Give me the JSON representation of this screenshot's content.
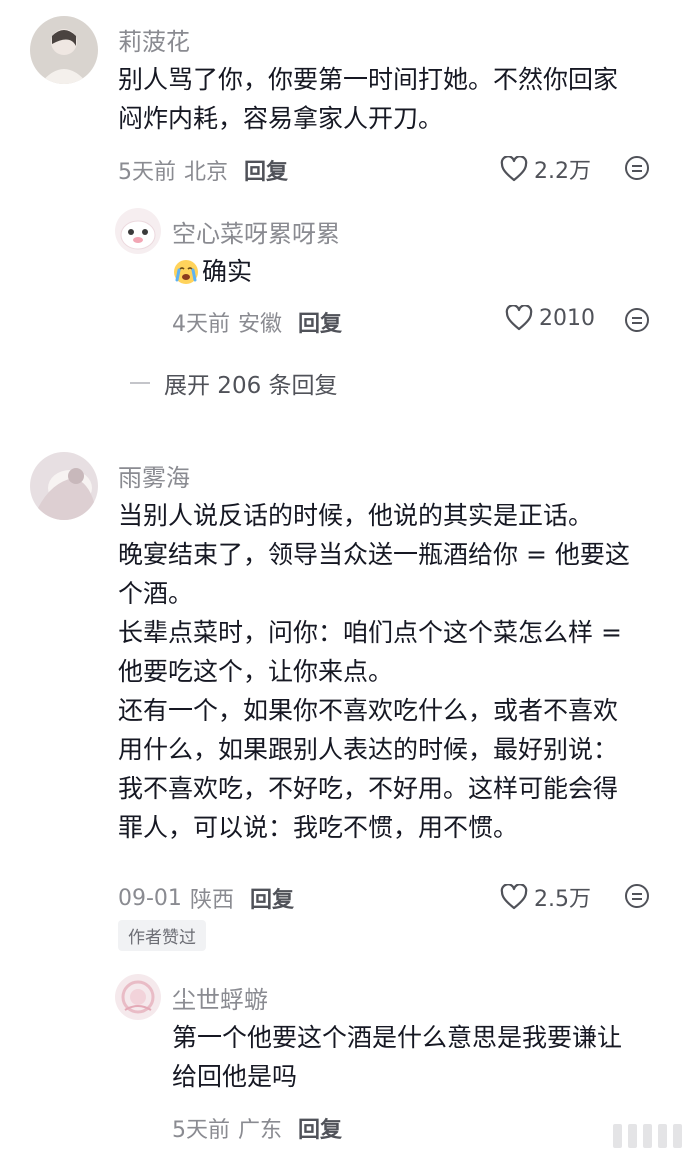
{
  "comments": [
    {
      "username": "莉菠花",
      "text_lines": [
        "别人骂了你，你要第一时间打她。不然你回家",
        "闷炸内耗，容易拿家人开刀。"
      ],
      "time": "5天前",
      "location": "北京",
      "reply_label": "回复",
      "likes": "2.2万",
      "replies": [
        {
          "username": "空心菜呀累呀累",
          "emoji_icon": "crying-face-emoji-icon",
          "text": "确实",
          "time": "4天前",
          "location": "安徽",
          "reply_label": "回复",
          "likes": "2010"
        }
      ],
      "expand_label": "展开 206 条回复"
    },
    {
      "username": "雨雾海",
      "text_lines": [
        "当别人说反话的时候，他说的其实是正话。",
        "晚宴结束了，领导当众送一瓶酒给你 = 他要这",
        "个酒。",
        "长辈点菜时，问你：咱们点个这个菜怎么样 =",
        "他要吃这个，让你来点。",
        "还有一个，如果你不喜欢吃什么，或者不喜欢",
        "用什么，如果跟别人表达的时候，最好别说：",
        "我不喜欢吃，不好吃，不好用。这样可能会得",
        "罪人，可以说：我吃不惯，用不惯。"
      ],
      "time": "09-01",
      "location": "陕西",
      "reply_label": "回复",
      "likes": "2.5万",
      "badge": "作者赞过",
      "replies": [
        {
          "username": "尘世蜉蝣",
          "text_lines": [
            "第一个他要这个酒是什么意思是我要谦让",
            "给回他是吗"
          ],
          "time": "5天前",
          "location": "广东",
          "reply_label": "回复"
        }
      ]
    }
  ],
  "icons": {
    "like": "heart-outline-icon",
    "dislike": "frown-face-icon"
  },
  "colors": {
    "text_primary": "#161823",
    "text_secondary": "#8a8b91",
    "action": "#505259"
  }
}
